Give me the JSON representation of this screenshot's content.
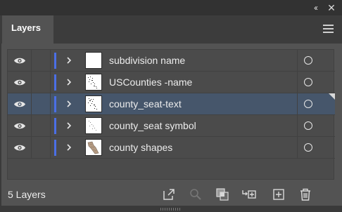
{
  "panel": {
    "tab_label": "Layers",
    "collapse_glyph": "‹‹",
    "close_glyph": "✕"
  },
  "layers": [
    {
      "name": "subdivision name",
      "visible": true,
      "selected": false,
      "thumbnail": "blank"
    },
    {
      "name": "USCounties -name",
      "visible": true,
      "selected": false,
      "thumbnail": "dots"
    },
    {
      "name": "county_seat-text",
      "visible": true,
      "selected": true,
      "thumbnail": "dots"
    },
    {
      "name": "county_seat symbol",
      "visible": true,
      "selected": false,
      "thumbnail": "dots-light"
    },
    {
      "name": "county shapes",
      "visible": true,
      "selected": false,
      "thumbnail": "shapes"
    }
  ],
  "footer": {
    "layer_count": "5 Layers",
    "icons": [
      "export-icon",
      "locate-object-icon",
      "make-clipping-mask-icon",
      "create-sublayer-icon",
      "create-new-layer-icon",
      "delete-icon"
    ]
  },
  "colors": {
    "panel_bg": "#535353",
    "row_bg": "#4b4b4b",
    "selected_row": "#46566b",
    "layer_color": "#4b6fe6"
  }
}
